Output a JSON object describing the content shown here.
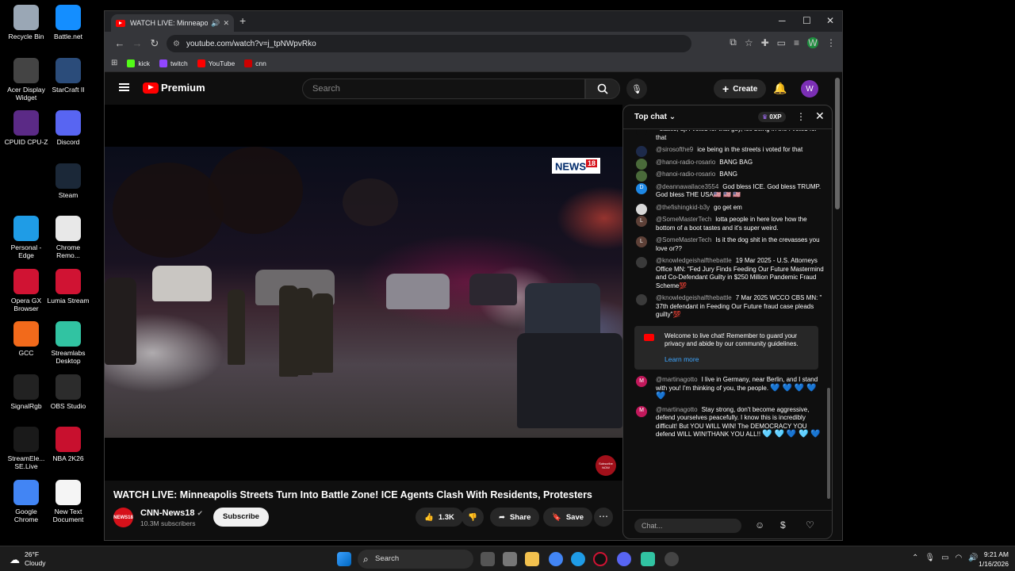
{
  "desktop": {
    "icons": [
      {
        "label": "Recycle Bin",
        "icon": "recycle-bin-icon",
        "color": "#9aa7b5"
      },
      {
        "label": "Battle.net",
        "icon": "battlenet-icon",
        "color": "#148eff"
      },
      {
        "label": "Acer Display Widget",
        "icon": "acer-display-icon",
        "color": "#444"
      },
      {
        "label": "StarCraft II",
        "icon": "starcraft-icon",
        "color": "#2b4c7a"
      },
      {
        "label": "CPUID CPU-Z",
        "icon": "cpuz-icon",
        "color": "#5b2a86"
      },
      {
        "label": "Discord",
        "icon": "discord-icon",
        "color": "#5865f2"
      },
      {
        "label": "Steam",
        "icon": "steam-icon",
        "color": "#1b2838"
      },
      {
        "label": "Personal - Edge",
        "icon": "edge-icon",
        "color": "#1f9ce6"
      },
      {
        "label": "Chrome Remo...",
        "icon": "chrome-remote-icon",
        "color": "#e8e8e8"
      },
      {
        "label": "Opera GX Browser",
        "icon": "opera-gx-icon",
        "color": "#d01333"
      },
      {
        "label": "Lumia Stream",
        "icon": "lumia-icon",
        "color": "#d01333"
      },
      {
        "label": "GCC",
        "icon": "gcc-icon",
        "color": "#f26a1b"
      },
      {
        "label": "Streamlabs Desktop",
        "icon": "streamlabs-icon",
        "color": "#31c3a2"
      },
      {
        "label": "SignalRgb",
        "icon": "signalrgb-icon",
        "color": "#222"
      },
      {
        "label": "OBS Studio",
        "icon": "obs-icon",
        "color": "#2c2c2c"
      },
      {
        "label": "StreamEle... SE.Live",
        "icon": "streamelements-icon",
        "color": "#1a1a1a"
      },
      {
        "label": "NBA 2K26",
        "icon": "nba2k-icon",
        "color": "#c8102e"
      },
      {
        "label": "Google Chrome",
        "icon": "chrome-icon",
        "color": "#4285f4"
      },
      {
        "label": "New Text Document",
        "icon": "text-document-icon",
        "color": "#f5f5f5"
      }
    ]
  },
  "browser": {
    "tab_title": "WATCH LIVE: Minneapolis S",
    "url": "youtube.com/watch?v=j_tpNWpvRko",
    "bookmarks": [
      {
        "label": "kick",
        "color": "#53fc18"
      },
      {
        "label": "twitch",
        "color": "#9146ff"
      },
      {
        "label": "YouTube",
        "color": "#ff0000"
      },
      {
        "label": "cnn",
        "color": "#cc0000"
      }
    ],
    "profile_initial": "W"
  },
  "youtube": {
    "logo_text": "Premium",
    "search_placeholder": "Search",
    "create_label": "Create",
    "avatar_initial": "W",
    "video": {
      "title": "WATCH LIVE: Minneapolis Streets Turn Into Battle Zone! ICE Agents Clash With Residents, Protesters",
      "watermark": "NEWS",
      "watermark_num": "18",
      "subscribe_badge": "Subscribe NOW"
    },
    "channel": {
      "name": "CNN-News18",
      "avatar_text": "NEWS18",
      "subscribers": "10.3M subscribers",
      "subscribe_label": "Subscribe"
    },
    "actions": {
      "likes": "1.3K",
      "share": "Share",
      "save": "Save"
    }
  },
  "chat": {
    "header": "Top chat",
    "xp": "0XP",
    "messages": [
      {
        "author": "",
        "text": "states, djt I voted for that guy, ice being in the I voted for that",
        "avatar_color": "#0f0f0f",
        "avatar_text": ""
      },
      {
        "author": "@sirosofthe9",
        "text": "ice being in the streets i voted for that",
        "avatar_color": "#1d2a4a",
        "avatar_text": ""
      },
      {
        "author": "@hanoi-radio-rosario",
        "text": "BANG BAG",
        "avatar_color": "#4a6a3a",
        "avatar_text": ""
      },
      {
        "author": "@hanoi-radio-rosario",
        "text": "BANG",
        "avatar_color": "#4a6a3a",
        "avatar_text": ""
      },
      {
        "author": "@deannawallace3554",
        "text": "God bless ICE. God bless TRUMP. God bless THE USA🇺🇸 🇺🇸 🇺🇸",
        "avatar_color": "#1e88e5",
        "avatar_text": "D"
      },
      {
        "author": "@thefishingkid-b3y",
        "text": "go get em",
        "avatar_color": "#d9d9d9",
        "avatar_text": ""
      },
      {
        "author": "@SomeMasterTech",
        "text": "lotta people in here love how the bottom of a boot tastes and it's super weird.",
        "avatar_color": "#5d4037",
        "avatar_text": "L"
      },
      {
        "author": "@SomeMasterTech",
        "text": "Is it the dog shit in the crevasses you love or??",
        "avatar_color": "#5d4037",
        "avatar_text": "L"
      },
      {
        "author": "@knowledgeishalfthebattle",
        "text": "19 Mar 2025 - U.S. Attorneys Office MN: \"Fed Jury Finds Feeding Our Future Mastermind and Co-Defendant Guilty in $250 Million Pandemic Fraud Scheme💯",
        "avatar_color": "#3a3a3a",
        "avatar_text": ""
      },
      {
        "author": "@knowledgeishalfthebattle",
        "text": "7 Mar 2025 WCCO CBS MN: \" 37th defendant in Feeding Our Future fraud case pleads guilty\"💯",
        "avatar_color": "#3a3a3a",
        "avatar_text": ""
      }
    ],
    "welcome": {
      "text": "Welcome to live chat! Remember to guard your privacy and abide by our community guidelines.",
      "learn_more": "Learn more"
    },
    "after_messages": [
      {
        "author": "@martinagotto",
        "text": "I live in Germany, near Berlin, and I stand with you! I'm thinking of you, the people.",
        "hearts": "💙 💙 💙 💙 💙",
        "avatar_color": "#c2185b",
        "avatar_text": "M"
      },
      {
        "author": "@martinagotto",
        "text": "Stay strong, don't become aggressive, defend yourselves peacefully. I know this is incredibly difficult! But YOU WILL WIN! The DEMOCRACY YOU defend WILL WIN!THANK YOU ALL!!",
        "hearts": "🩵 🩵 💙 🩵 💙",
        "avatar_color": "#c2185b",
        "avatar_text": "M"
      }
    ],
    "input_placeholder": "Chat..."
  },
  "taskbar": {
    "temperature": "26°F",
    "condition": "Cloudy",
    "search_label": "Search",
    "time": "9:21 AM",
    "date": "1/16/2026"
  }
}
